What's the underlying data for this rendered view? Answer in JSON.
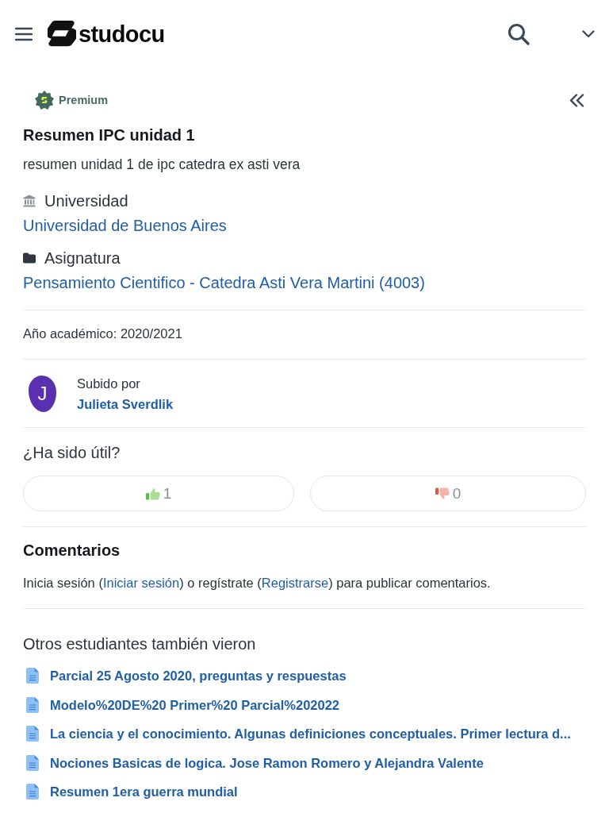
{
  "header": {
    "logo_text": "studocu"
  },
  "document": {
    "badge": "Premium",
    "title": "Resumen IPC unidad 1",
    "description": "resumen unidad 1 de ipc catedra ex asti vera",
    "fields": [
      {
        "kind": "university",
        "label": "Universidad",
        "value": "Universidad de Buenos Aires"
      },
      {
        "kind": "subject",
        "label": "Asignatura",
        "value": "Pensamiento Cientifico - Catedra Asti Vera Martini (4003)"
      }
    ],
    "academic_year": "Año académico: 2020/2021"
  },
  "uploader": {
    "avatar_letter": "J",
    "label": "Subido por",
    "name": "Julieta Sverdlik"
  },
  "feedback": {
    "question": "¿Ha sido útil?",
    "votes": [
      {
        "kind": "up",
        "count": "1"
      },
      {
        "kind": "down",
        "count": "0"
      }
    ]
  },
  "comments": {
    "heading": "Comentarios",
    "message": [
      {
        "kind": "text",
        "text": "Inicia sesión ("
      },
      {
        "kind": "link",
        "text": "Iniciar sesión"
      },
      {
        "kind": "text",
        "text": ") o regístrate ("
      },
      {
        "kind": "link",
        "text": "Registrarse"
      },
      {
        "kind": "text",
        "text": ") para publicar comentarios."
      }
    ]
  },
  "related": {
    "heading": "Otros estudiantes también vieron",
    "items": [
      "Parcial 25 Agosto 2020, preguntas y respuestas",
      "Modelo%20DE%20 Primer%20 Parcial%202022",
      "La ciencia y el conocimiento. Algunas definiciones conceptuales. Primer lectura d...",
      "Nociones Basicas de logica. Jose Ramon Romero y Alejandra Valente",
      "Resumen 1era guerra mundial"
    ]
  }
}
